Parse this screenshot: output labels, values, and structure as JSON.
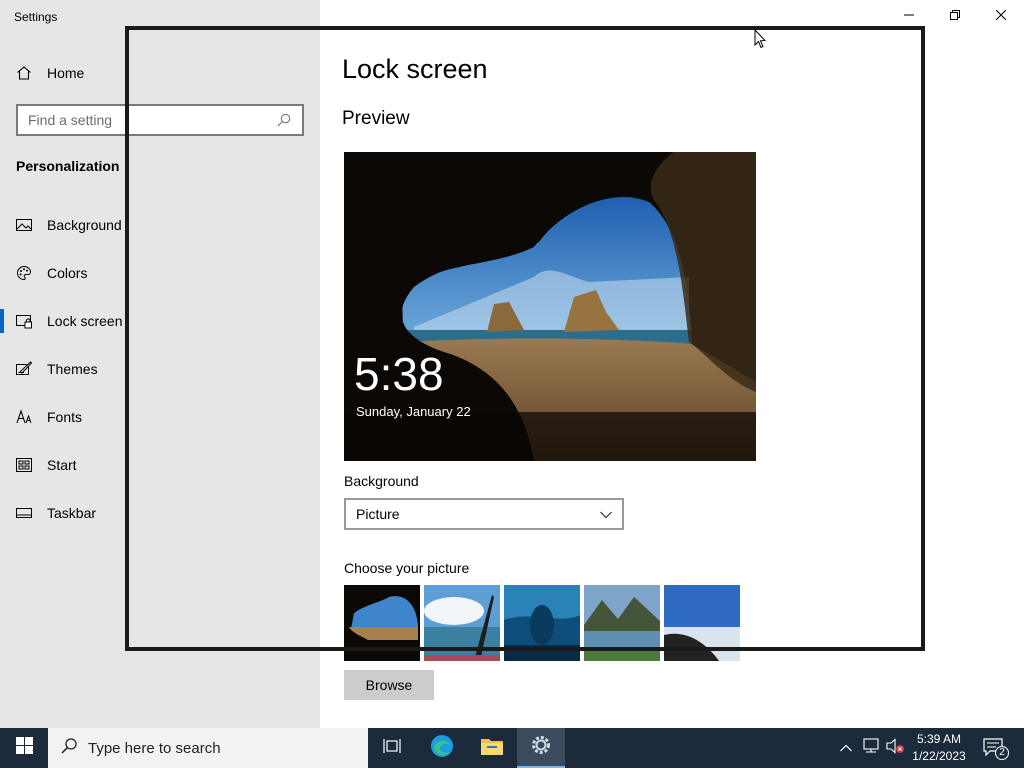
{
  "window": {
    "title": "Settings"
  },
  "sidebar": {
    "home_label": "Home",
    "search_placeholder": "Find a setting",
    "section_title": "Personalization",
    "items": [
      {
        "label": "Background",
        "icon": "image-icon",
        "active": false
      },
      {
        "label": "Colors",
        "icon": "palette-icon",
        "active": false
      },
      {
        "label": "Lock screen",
        "icon": "lock-screen-icon",
        "active": true
      },
      {
        "label": "Themes",
        "icon": "themes-icon",
        "active": false
      },
      {
        "label": "Fonts",
        "icon": "fonts-icon",
        "active": false
      },
      {
        "label": "Start",
        "icon": "start-icon",
        "active": false
      },
      {
        "label": "Taskbar",
        "icon": "taskbar-icon",
        "active": false
      }
    ]
  },
  "main": {
    "title": "Lock screen",
    "preview_title": "Preview",
    "preview": {
      "time": "5:38",
      "date": "Sunday, January 22"
    },
    "background_label": "Background",
    "background_value": "Picture",
    "choose_label": "Choose your picture",
    "browse_label": "Browse"
  },
  "taskbar": {
    "search_placeholder": "Type here to search",
    "time": "5:39 AM",
    "date": "1/22/2023",
    "notification_count": "2"
  },
  "colors": {
    "accent": "#0067c0",
    "sidebar_bg": "#e6e6e6",
    "taskbar_bg": "#1c2b3c"
  }
}
